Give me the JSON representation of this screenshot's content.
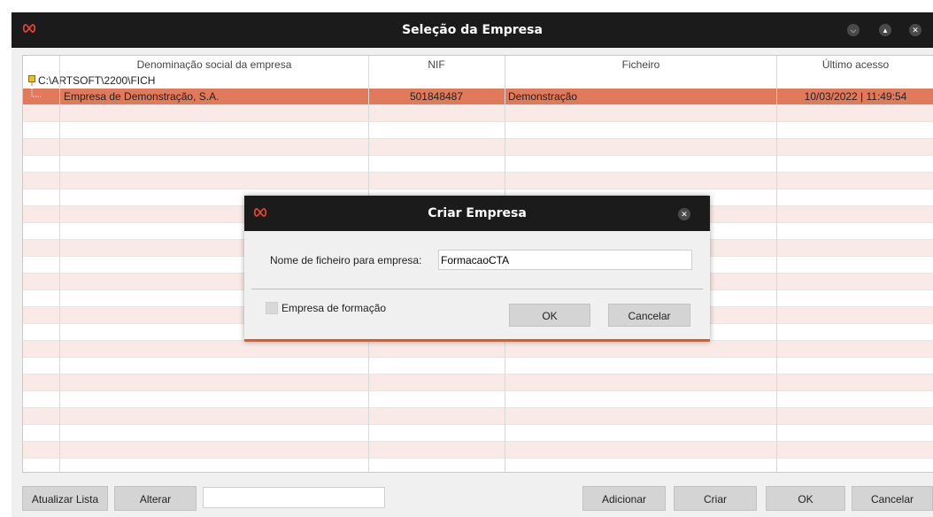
{
  "window": {
    "title": "Seleção da Empresa"
  },
  "columns": [
    "Denominação social da empresa",
    "NIF",
    "Ficheiro",
    "Último acesso"
  ],
  "tree_path": "C:\\ARTSOFT\\2200\\FICH",
  "companies": [
    {
      "name": "Empresa de Demonstração, S.A.",
      "nif": "501848487",
      "file": "Demonstração",
      "last_access": "10/03/2022 | 11:49:54"
    }
  ],
  "toolbar": {
    "refresh_label": "Atualizar Lista",
    "edit_label": "Alterar",
    "search_value": "",
    "add_label": "Adicionar",
    "create_label": "Criar",
    "ok_label": "OK",
    "cancel_label": "Cancelar"
  },
  "dialog": {
    "title": "Criar Empresa",
    "filename_label": "Nome de ficheiro para empresa:",
    "filename_value": "FormacaoCTA",
    "training_label": "Empresa de formação",
    "ok_label": "OK",
    "cancel_label": "Cancelar"
  },
  "colors": {
    "accent": "#e85a1c",
    "selected_row": "#e07a5a",
    "alt_row": "#faeae7",
    "titlebar": "#1b1b1b"
  },
  "icons": [
    "artsoft-logo-icon",
    "minimize-icon",
    "maximize-icon",
    "close-icon",
    "folder-icon"
  ]
}
